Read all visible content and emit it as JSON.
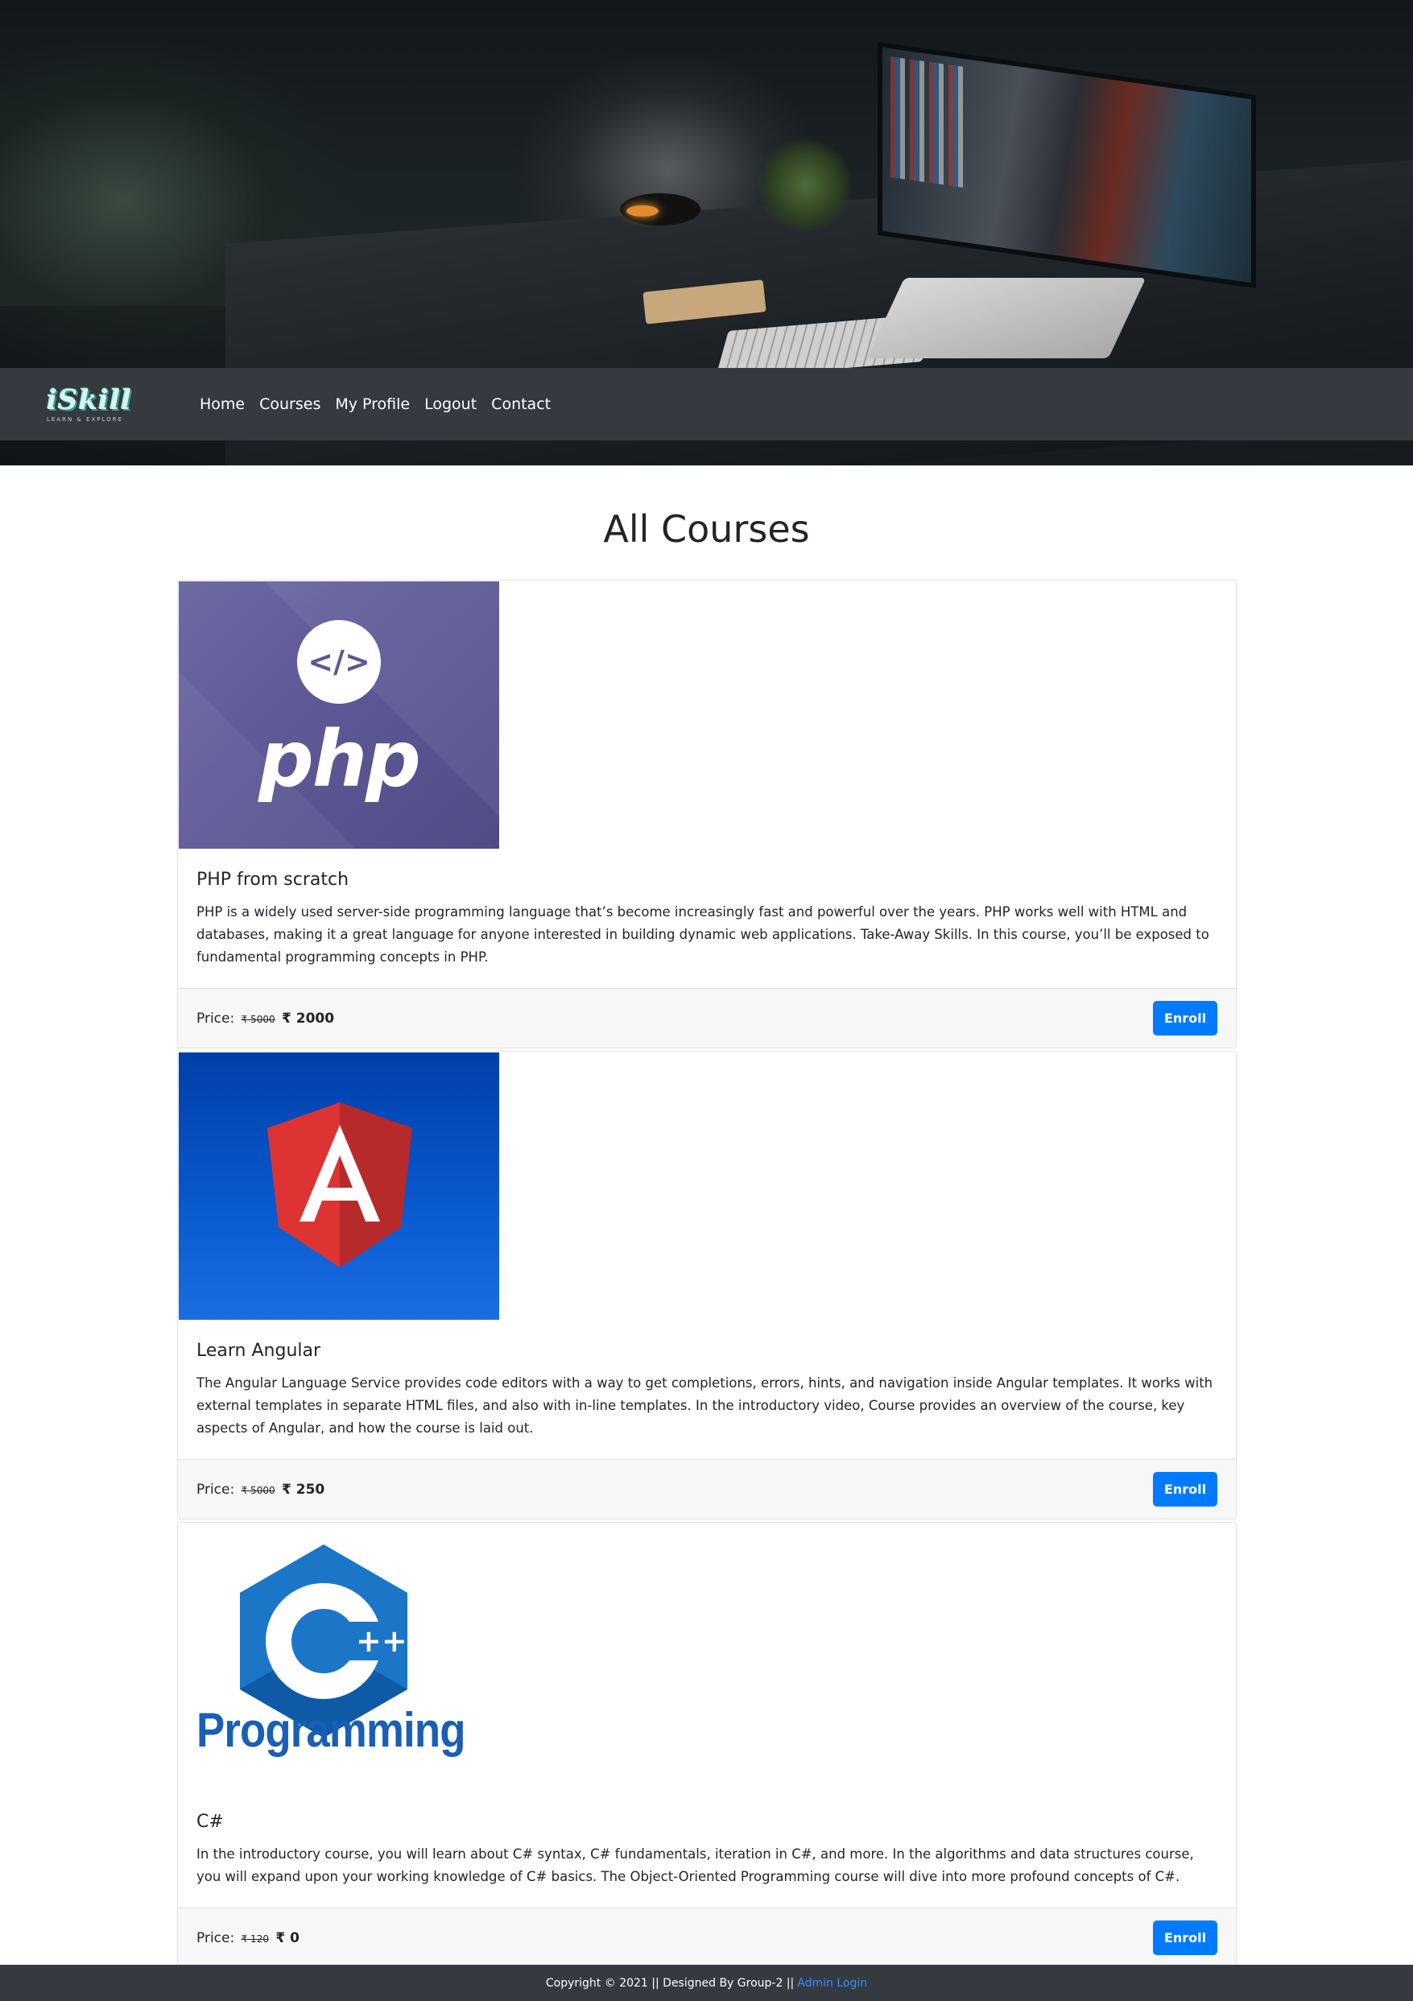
{
  "brand": {
    "name": "iSkill",
    "tagline": "LEARN & EXPLORE"
  },
  "nav": {
    "items": [
      "Home",
      "Courses",
      "My Profile",
      "Logout",
      "Contact"
    ]
  },
  "main": {
    "title": "All Courses"
  },
  "courses": [
    {
      "image_icon": "php-logo",
      "title": "PHP from scratch",
      "description": "PHP is a widely used server-side programming language that’s become increasingly fast and powerful over the years. PHP works well with HTML and databases, making it a great language for anyone interested in building dynamic web applications. Take-Away Skills. In this course, you’ll be exposed to fundamental programming concepts in PHP.",
      "price_label": "Price:",
      "old_price": "₹ 5000",
      "new_price": "₹ 2000",
      "button": "Enroll"
    },
    {
      "image_icon": "angular-logo",
      "title": "Learn Angular",
      "description": "The Angular Language Service provides code editors with a way to get completions, errors, hints, and navigation inside Angular templates. It works with external templates in separate HTML files, and also with in-line templates. In the introductory video, Course provides an overview of the course, key aspects of Angular, and how the course is laid out.",
      "price_label": "Price:",
      "old_price": "₹ 5000",
      "new_price": "₹ 250",
      "button": "Enroll"
    },
    {
      "image_icon": "cpp-programming-logo",
      "image_text": "Programming",
      "title": "C#",
      "description": "In the introductory course, you will learn about C# syntax, C# fundamentals, iteration in C#, and more. In the algorithms and data structures course, you will expand upon your working knowledge of C# basics. The Object-Oriented Programming course will dive into more profound concepts of C#.",
      "price_label": "Price:",
      "old_price": "₹ 120",
      "new_price": "₹ 0",
      "button": "Enroll"
    }
  ],
  "footer": {
    "text": "Copyright © 2021 || Designed By Group-2 ||",
    "admin_link": "Admin Login"
  },
  "colors": {
    "navbar": "#343a40",
    "primary": "#007bff",
    "footer_link": "#3b8cff"
  }
}
